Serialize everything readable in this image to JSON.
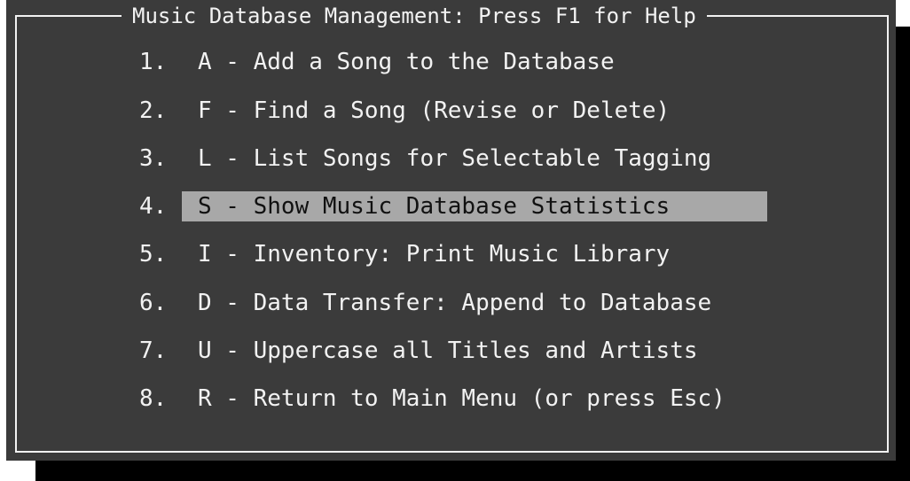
{
  "window": {
    "title": "Music Database Management: Press F1 for Help"
  },
  "menu": {
    "items": [
      {
        "number": "1.",
        "label": "A - Add a Song to the Database",
        "selected": false
      },
      {
        "number": "2.",
        "label": "F - Find a Song (Revise or Delete)",
        "selected": false
      },
      {
        "number": "3.",
        "label": "L - List Songs for Selectable Tagging",
        "selected": false
      },
      {
        "number": "4.",
        "label": "S - Show Music Database Statistics",
        "selected": true
      },
      {
        "number": "5.",
        "label": "I - Inventory: Print Music Library",
        "selected": false
      },
      {
        "number": "6.",
        "label": "D - Data Transfer: Append to Database",
        "selected": false
      },
      {
        "number": "7.",
        "label": "U - Uppercase all Titles and Artists",
        "selected": false
      },
      {
        "number": "8.",
        "label": "R - Return to Main Menu (or press Esc)",
        "selected": false
      }
    ]
  },
  "colors": {
    "panel_background": "#3b3b3b",
    "shadow": "#000000",
    "text": "#f2f2f2",
    "highlight_background": "#a8a8a8",
    "highlight_text": "#111111"
  }
}
